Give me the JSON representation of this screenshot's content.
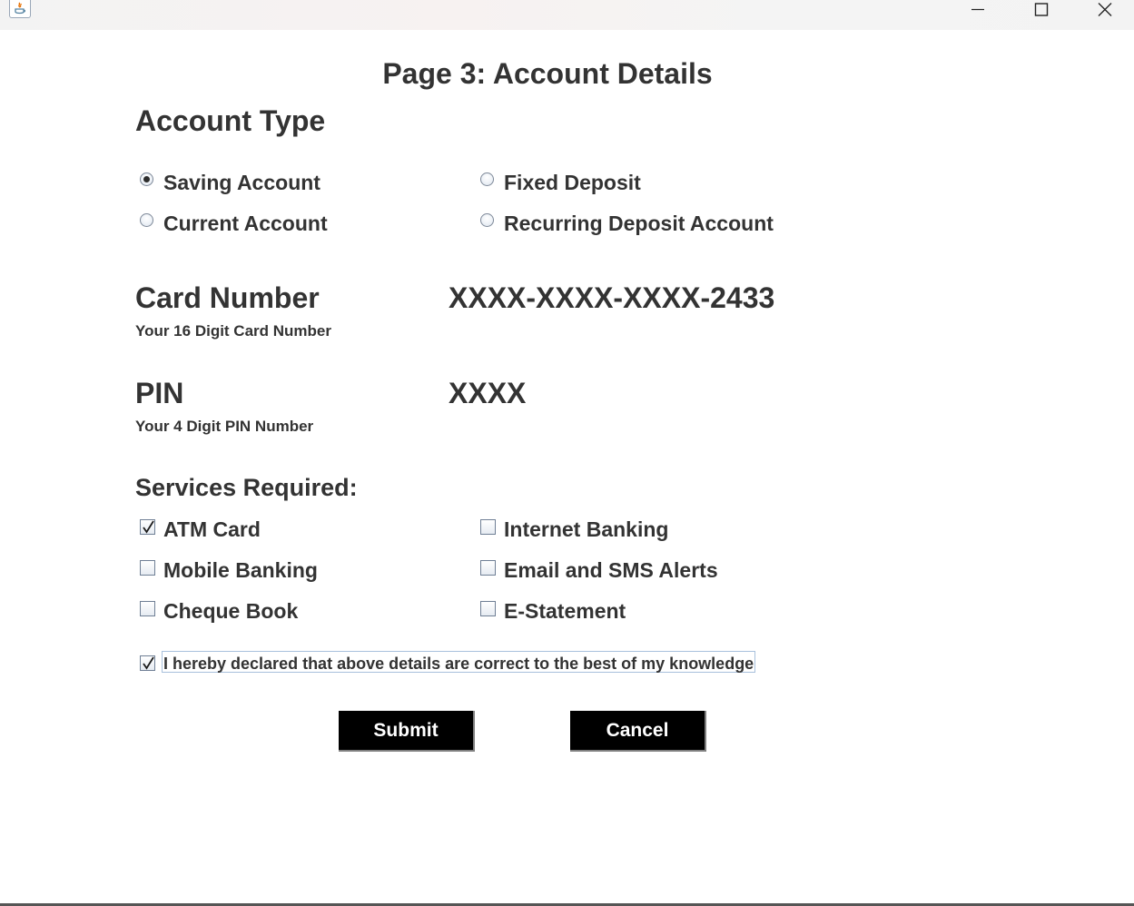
{
  "window": {
    "icons": {
      "app": "java-icon",
      "minimize": "minimize-icon",
      "maximize": "maximize-icon",
      "close": "close-icon"
    }
  },
  "page_title": "Page 3: Account Details",
  "account_type": {
    "heading": "Account Type",
    "options": [
      {
        "label": "Saving Account",
        "selected": true
      },
      {
        "label": "Fixed Deposit",
        "selected": false
      },
      {
        "label": "Current Account",
        "selected": false
      },
      {
        "label": "Recurring Deposit Account",
        "selected": false
      }
    ]
  },
  "card_number": {
    "heading": "Card Number",
    "hint": "Your 16 Digit Card Number",
    "value": "XXXX-XXXX-XXXX-2433"
  },
  "pin": {
    "heading": "PIN",
    "hint": "Your 4 Digit PIN Number",
    "value": "XXXX"
  },
  "services": {
    "heading": "Services Required:",
    "options": [
      {
        "label": "ATM Card",
        "checked": true
      },
      {
        "label": "Internet Banking",
        "checked": false
      },
      {
        "label": "Mobile Banking",
        "checked": false
      },
      {
        "label": "Email and SMS Alerts",
        "checked": false
      },
      {
        "label": "Cheque Book",
        "checked": false
      },
      {
        "label": "E-Statement",
        "checked": false
      }
    ]
  },
  "declaration": {
    "label": "I hereby declared that above details are correct to the best of my knowledge",
    "checked": true
  },
  "buttons": {
    "submit": "Submit",
    "cancel": "Cancel"
  },
  "colors": {
    "button_bg": "#000000",
    "button_text": "#ffffff",
    "text": "#333333"
  }
}
